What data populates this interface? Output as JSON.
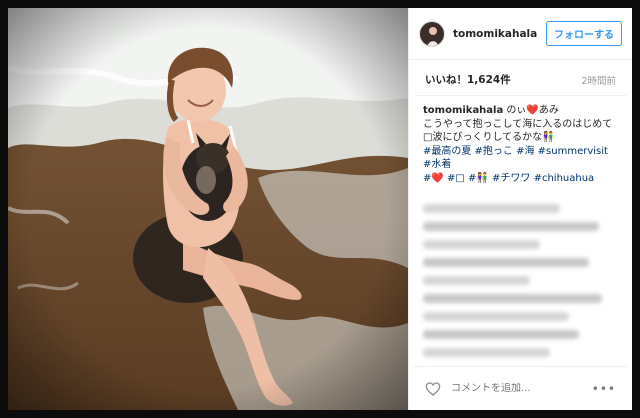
{
  "post": {
    "username": "tomomikahala",
    "follow_label": "フォローする",
    "likes": "いいね！1,624件",
    "time_ago": "2時間前",
    "caption": {
      "user": "tomomikahala",
      "line1": "のぃ❤️あみ",
      "line2": "こうやって抱っこして海に入るのはじめて",
      "line3": "□波にびっくりしてるかな👫",
      "tags_line1": "#最高の夏 #抱っこ #海 #summervisit #水着",
      "tags_line2": "#❤️ #□ #👫 #チワワ #chihuahua"
    },
    "comment_placeholder": "コメントを追加...",
    "more_label": "•••"
  },
  "icons": {
    "heart": "heart-outline-icon",
    "more": "more-options-icon"
  },
  "colors": {
    "follow_blue": "#3897f0",
    "hashtag": "#003569"
  }
}
